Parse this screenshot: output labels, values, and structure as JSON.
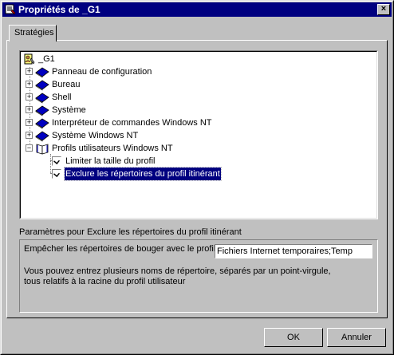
{
  "window": {
    "title": "Propriétés de _G1",
    "close_label": "×"
  },
  "tabs": [
    {
      "label": "Stratégies"
    }
  ],
  "tree": {
    "root": "_G1",
    "items": [
      {
        "label": "Panneau de configuration",
        "icon": "book-icon"
      },
      {
        "label": "Bureau",
        "icon": "book-icon"
      },
      {
        "label": "Shell",
        "icon": "book-icon"
      },
      {
        "label": "Système",
        "icon": "book-icon"
      },
      {
        "label": "Interpréteur de commandes Windows NT",
        "icon": "book-icon"
      },
      {
        "label": "Système Windows NT",
        "icon": "book-icon"
      },
      {
        "label": "Profils utilisateurs Windows NT",
        "icon": "open-book-icon"
      }
    ],
    "children": [
      {
        "label": "Limiter la taille du profil",
        "checked": true
      },
      {
        "label": "Exclure les répertoires du profil itinérant",
        "checked": true,
        "selected": true
      }
    ]
  },
  "params": {
    "label": "Paramètres pour Exclure les répertoires du profil itinérant",
    "field_label": "Empêcher les répertoires de bouger avec le profil :",
    "field_value": "Fichiers Internet temporaires;Temp",
    "help_line1": "Vous pouvez entrez plusieurs noms de répertoire, séparés par un point-virgule,",
    "help_line2": "tous relatifs à la racine du profil utilisateur"
  },
  "buttons": {
    "ok": "OK",
    "cancel": "Annuler"
  },
  "colors": {
    "titlebar": "#000080",
    "book": "#0000c0",
    "selection": "#000080"
  }
}
